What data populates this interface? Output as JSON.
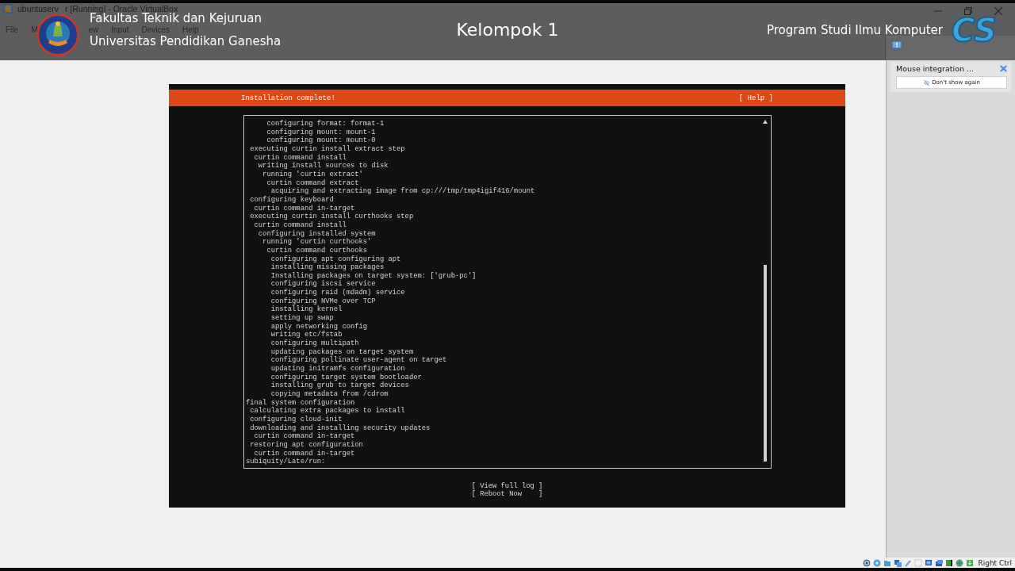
{
  "window": {
    "title_parts": [
      "ubuntuserv",
      "r [Running] - Oracle VirtualBox"
    ],
    "menu": [
      "File",
      "M",
      "ew",
      "Input",
      "Devices",
      "Help"
    ]
  },
  "banner": {
    "faculty": "Fakultas Teknik dan Kejuruan",
    "university": "Universitas Pendidikan Ganesha",
    "title": "Kelompok 1",
    "program": "Program Studi Ilmu Komputer",
    "logo_text": "CS"
  },
  "installer": {
    "header": "Installation complete!",
    "help": "[ Help ]",
    "log_lines": [
      "     configuring format: format-1",
      "     configuring mount: mount-1",
      "     configuring mount: mount-0",
      " executing curtin install extract step",
      "  curtin command install",
      "   writing install sources to disk",
      "    running 'curtin extract'",
      "     curtin command extract",
      "      acquiring and extracting image from cp:///tmp/tmp4igif416/mount",
      " configuring keyboard",
      "  curtin command in-target",
      " executing curtin install curthooks step",
      "  curtin command install",
      "   configuring installed system",
      "    running 'curtin curthooks'",
      "     curtin command curthooks",
      "      configuring apt configuring apt",
      "      installing missing packages",
      "      Installing packages on target system: ['grub-pc']",
      "      configuring iscsi service",
      "      configuring raid (mdadm) service",
      "      configuring NVMe over TCP",
      "      installing kernel",
      "      setting up swap",
      "      apply networking config",
      "      writing etc/fstab",
      "      configuring multipath",
      "      updating packages on target system",
      "      configuring pollinate user-agent on target",
      "      updating initramfs configuration",
      "      configuring target system bootloader",
      "      installing grub to target devices",
      "      copying metadata from /cdrom",
      "final system configuration",
      " calculating extra packages to install",
      " configuring cloud-init",
      " downloading and installing security updates",
      "  curtin command in-target",
      " restoring apt configuration",
      "  curtin command in-target",
      "subiquity/Late/run:"
    ],
    "buttons": [
      "[ View full log ]",
      "[ Reboot Now    ]"
    ]
  },
  "notification": {
    "title": "Mouse integration ...",
    "button": "Don't show again"
  },
  "status_bar": {
    "host_key": "Right Ctrl"
  }
}
